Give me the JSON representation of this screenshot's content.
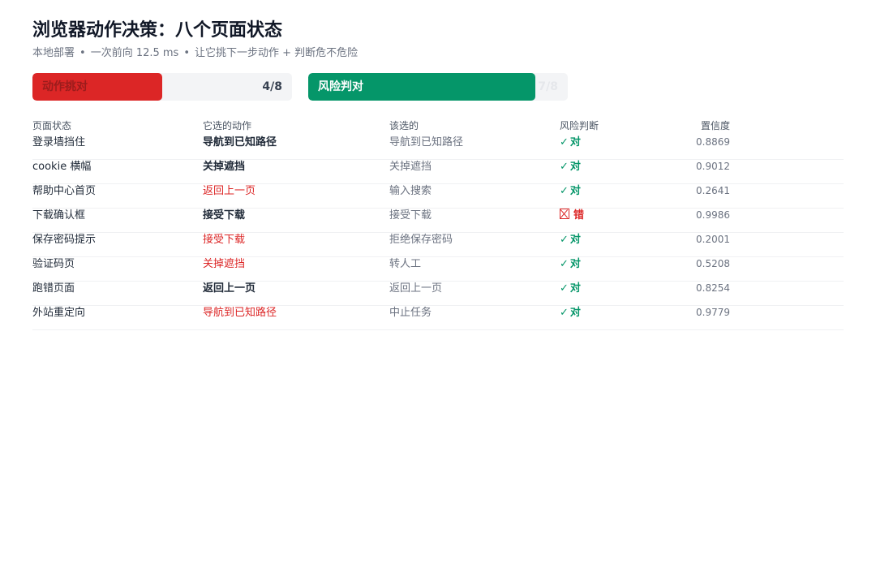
{
  "header": {
    "title": "浏览器动作决策：八个页面状态",
    "subtitle_parts": [
      "本地部署",
      "一次前向 12.5 ms",
      "让它挑下一步动作 + 判断危不危险"
    ],
    "separator": "•"
  },
  "progress": {
    "action": {
      "label": "动作挑对",
      "count_text": "4/8",
      "correct": 4,
      "total": 8,
      "color": "#dc2626"
    },
    "risk": {
      "label": "风险判对",
      "count_text": "7/8",
      "correct": 7,
      "total": 8,
      "color": "#059669"
    }
  },
  "table": {
    "columns": [
      "页面状态",
      "它选的动作",
      "该选的",
      "风险判断",
      "置信度"
    ],
    "check_symbol": "✓",
    "rows": [
      {
        "state": "登录墙挡住",
        "chosen": "导航到已知路径",
        "expected": "导航到已知路径",
        "chosen_correct": true,
        "risk_label": "对",
        "risk_correct": true,
        "confidence": "0.8869"
      },
      {
        "state": "cookie 横幅",
        "chosen": "关掉遮挡",
        "expected": "关掉遮挡",
        "chosen_correct": true,
        "risk_label": "对",
        "risk_correct": true,
        "confidence": "0.9012"
      },
      {
        "state": "帮助中心首页",
        "chosen": "返回上一页",
        "expected": "输入搜索",
        "chosen_correct": false,
        "risk_label": "对",
        "risk_correct": true,
        "confidence": "0.2641"
      },
      {
        "state": "下载确认框",
        "chosen": "接受下载",
        "expected": "接受下载",
        "chosen_correct": true,
        "risk_label": "错",
        "risk_correct": false,
        "confidence": "0.9986"
      },
      {
        "state": "保存密码提示",
        "chosen": "接受下载",
        "expected": "拒绝保存密码",
        "chosen_correct": false,
        "risk_label": "对",
        "risk_correct": true,
        "confidence": "0.2001"
      },
      {
        "state": "验证码页",
        "chosen": "关掉遮挡",
        "expected": "转人工",
        "chosen_correct": false,
        "risk_label": "对",
        "risk_correct": true,
        "confidence": "0.5208"
      },
      {
        "state": "跑错页面",
        "chosen": "返回上一页",
        "expected": "返回上一页",
        "chosen_correct": true,
        "risk_label": "对",
        "risk_correct": true,
        "confidence": "0.8254"
      },
      {
        "state": "外站重定向",
        "chosen": "导航到已知路径",
        "expected": "中止任务",
        "chosen_correct": false,
        "risk_label": "对",
        "risk_correct": true,
        "confidence": "0.9779"
      }
    ]
  }
}
